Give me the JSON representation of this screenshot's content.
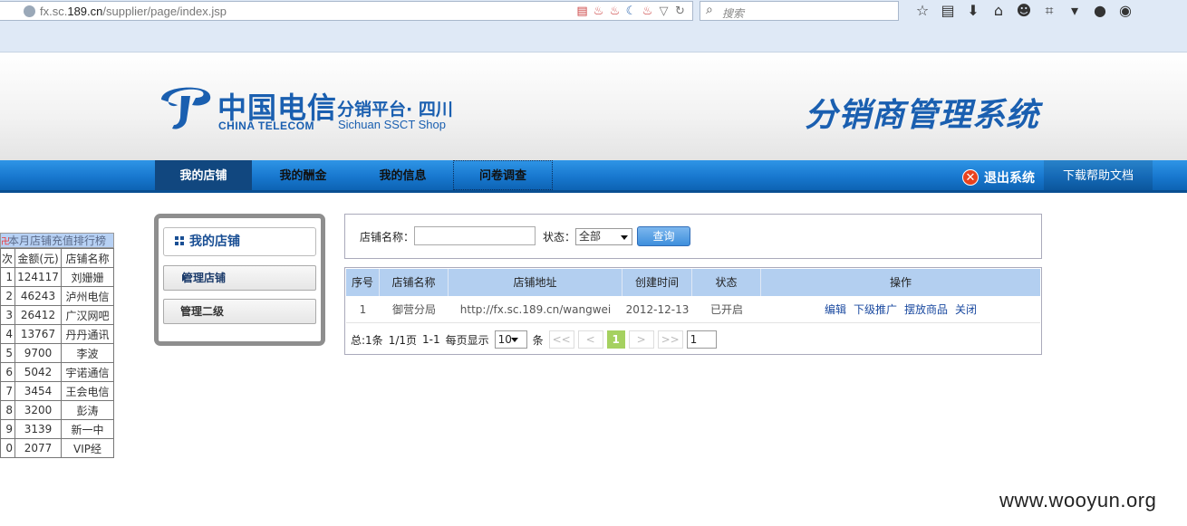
{
  "browser": {
    "url_prefix": "fx.sc.",
    "url_domain": "189.cn",
    "url_path": "/supplier/page/index.jsp",
    "search_placeholder": "搜索"
  },
  "header": {
    "logo_cn": "中国电信",
    "logo_en": "CHINA TELECOM",
    "platform": "分销平台· 四川",
    "shop": "Sichuan SSCT Shop",
    "system_title": "分销商管理系统",
    "brand_color": "#1a5fb0"
  },
  "nav": {
    "items": [
      "我的店铺",
      "我的酬金",
      "我的信息",
      "问卷调查"
    ],
    "logout": "退出系统",
    "help": "下载帮助文档"
  },
  "ranking": {
    "title": "本月店铺充值排行榜",
    "headers": [
      "次",
      "金额(元)",
      "店铺名称"
    ],
    "rows": [
      [
        "1",
        "124117",
        "刘姗姗"
      ],
      [
        "2",
        "46243",
        "泸州电信"
      ],
      [
        "3",
        "26412",
        "广汉网吧"
      ],
      [
        "4",
        "13767",
        "丹丹通讯"
      ],
      [
        "5",
        "9700",
        "李波"
      ],
      [
        "6",
        "5042",
        "宇诺通信"
      ],
      [
        "7",
        "3454",
        "王会电信"
      ],
      [
        "8",
        "3200",
        "彭涛"
      ],
      [
        "9",
        "3139",
        "新一中"
      ],
      [
        "0",
        "2077",
        "VIP经"
      ]
    ]
  },
  "sidebar": {
    "title": "我的店铺",
    "items": [
      "管理店铺",
      "管理二级"
    ]
  },
  "search": {
    "name_label": "店铺名称：",
    "name_value": "",
    "status_label": "状态：",
    "status_value": "全部",
    "query_button": "查询"
  },
  "table": {
    "headers": [
      "序号",
      "店铺名称",
      "店铺地址",
      "创建时间",
      "状态",
      "操作"
    ],
    "rows": [
      {
        "no": "1",
        "name": "御营分局",
        "address": "http://fx.sc.189.cn/wangwei",
        "created": "2012-12-13",
        "status": "已开启",
        "ops": [
          "编辑",
          "下级推广",
          "摆放商品",
          "关闭"
        ]
      }
    ]
  },
  "pager": {
    "total": "总:1条",
    "pages": "1/1页",
    "range": "1-1",
    "per_page_label": "每页显示",
    "per_page": "10",
    "unit": "条",
    "first": "<<",
    "prev": "<",
    "current": "1",
    "next": ">",
    "last": ">>",
    "goto_value": "1"
  },
  "watermark": "www.wooyun.org"
}
